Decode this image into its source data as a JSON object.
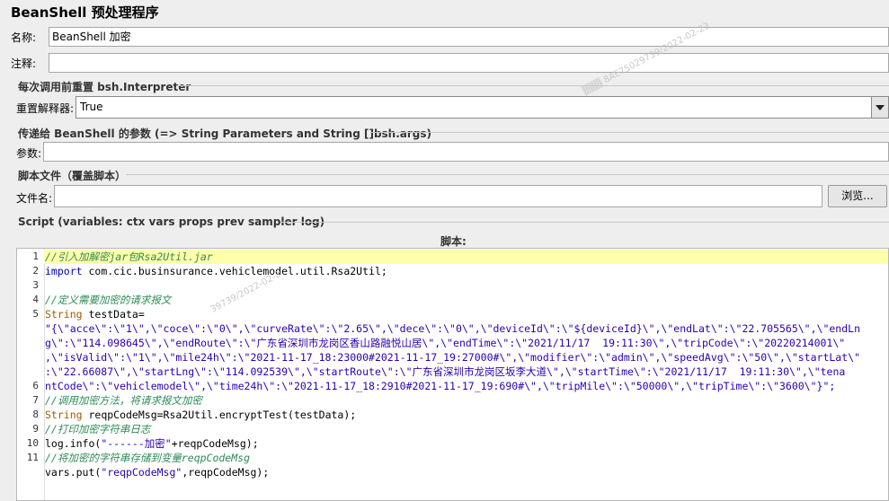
{
  "panel": {
    "title": "BeanShell 预处理程序"
  },
  "name_field": {
    "label": "名称:",
    "value": "BeanShell 加密"
  },
  "comment_field": {
    "label": "注释:",
    "value": ""
  },
  "reset_group": {
    "title": "每次调用前重置 bsh.Interpreter",
    "label": "重置解释器:",
    "selected": "True"
  },
  "params_group": {
    "title": "传递给 BeanShell 的参数 (=> String Parameters and String []bsh.args)",
    "label": "参数:",
    "value": ""
  },
  "file_group": {
    "title": "脚本文件（覆盖脚本）",
    "label": "文件名:",
    "value": "",
    "browse_label": "浏览..."
  },
  "script_group": {
    "title": "Script (variables: ctx vars props prev sampler log)",
    "script_label": "脚本:"
  },
  "editor": {
    "line_numbers": [
      "1",
      "2",
      "3",
      "4",
      "5",
      "6",
      "7",
      "8",
      "9",
      "10",
      "11"
    ],
    "lines": [
      {
        "kind": "comment",
        "text": "//引入加解密jar包Rsa2Util.jar"
      },
      {
        "kind": "import",
        "kw": "import",
        "rest": " com.cic.businsurance.vehiclemodel.util.Rsa2Util;"
      },
      {
        "kind": "blank",
        "text": ""
      },
      {
        "kind": "comment",
        "text": "//定义需要加密的请求报文"
      },
      {
        "kind": "decl",
        "type": "String",
        "rest": " testData="
      },
      {
        "kind": "str",
        "text": "\"{\\\"acce\\\":\\\"1\\\",\\\"coce\\\":\\\"0\\\",\\\"curveRate\\\":\\\"2.65\\\",\\\"dece\\\":\\\"0\\\",\\\"deviceId\\\":\\\"${deviceId}\\\",\\\"endLat\\\":\\\"22.705565\\\",\\\"endLn"
      },
      {
        "kind": "str",
        "text": "g\\\":\\\"114.098645\\\",\\\"endRoute\\\":\\\"广东省深圳市龙岗区香山路融悦山居\\\",\\\"endTime\\\":\\\"2021/11/17  19:11:30\\\",\\\"tripCode\\\":\\\"20220214001\\\""
      },
      {
        "kind": "str",
        "text": ",\\\"isValid\\\":\\\"1\\\",\\\"mile24h\\\":\\\"2021-11-17_18:23000#2021-11-17_19:27000#\\\",\\\"modifier\\\":\\\"admin\\\",\\\"speedAvg\\\":\\\"50\\\",\\\"startLat\\\""
      },
      {
        "kind": "str",
        "text": ":\\\"22.66087\\\",\\\"startLng\\\":\\\"114.092539\\\",\\\"startRoute\\\":\\\"广东省深圳市龙岗区坂李大道\\\",\\\"startTime\\\":\\\"2021/11/17  19:11:30\\\",\\\"tena"
      },
      {
        "kind": "str",
        "text": "ntCode\\\":\\\"vehiclemodel\\\",\\\"time24h\\\":\\\"2021-11-17_18:2910#2021-11-17_19:690#\\\",\\\"tripMile\\\":\\\"50000\\\",\\\"tripTime\\\":\\\"3600\\\"}\";"
      },
      {
        "kind": "comment",
        "text": "//调用加密方法，将请求报文加密"
      },
      {
        "kind": "decl",
        "type": "String",
        "rest": " reqpCodeMsg=Rsa2Util.encryptTest(testData);"
      },
      {
        "kind": "comment",
        "text": "//打印加密字符串日志"
      },
      {
        "kind": "call",
        "pre": "log.info(",
        "s": "\"------加密\"",
        "post": "+reqpCodeMsg);"
      },
      {
        "kind": "comment",
        "text": "//将加密的字符串存储到变量reqpCodeMsg"
      },
      {
        "kind": "call",
        "pre": "vars.put(",
        "s": "\"reqpCodeMsg\"",
        "post": ",reqpCodeMsg);"
      }
    ]
  },
  "colors": {
    "highlight": "#ffffaa",
    "comment": "#2e8b57",
    "keyword": "#0000c0",
    "string": "#2a00b0"
  }
}
